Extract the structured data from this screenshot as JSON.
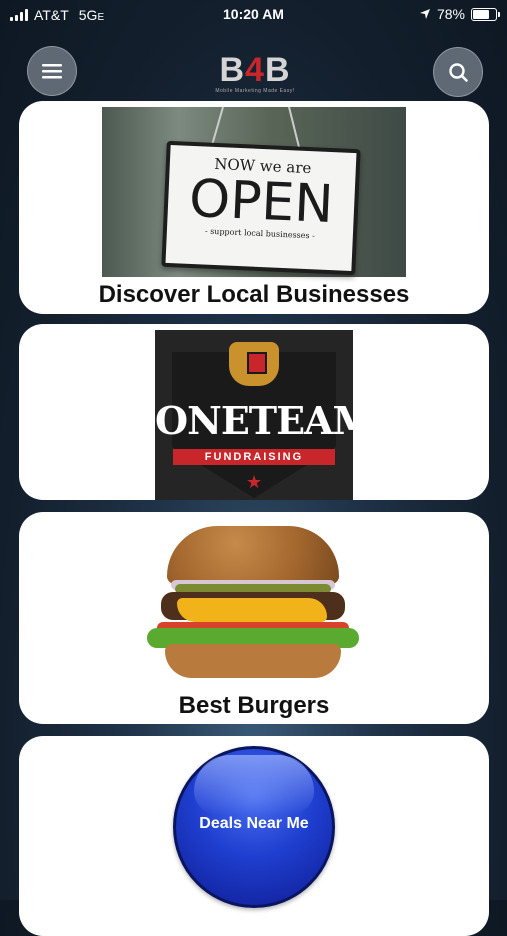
{
  "status_bar": {
    "carrier": "AT&T",
    "network": "5G",
    "network_suffix": "E",
    "time": "10:20 AM",
    "battery": "78%",
    "battery_level": 0.78
  },
  "header": {
    "logo_text_b1": "B",
    "logo_text_4": "4",
    "logo_text_b2": "B",
    "logo_subtitle": "Mobile Marketing Made Easy!",
    "menu_icon": "hamburger-icon",
    "search_icon": "search-icon"
  },
  "cards": [
    {
      "title": "Discover Local Businesses",
      "sign_top": "NOW we are",
      "sign_main": "OPEN",
      "sign_bottom": "- support local businesses -"
    },
    {
      "brand": "ONETEAM",
      "ribbon": "FUNDRAISING"
    },
    {
      "title": "Best Burgers"
    },
    {
      "button_label": "Deals Near Me"
    }
  ],
  "colors": {
    "accent_red": "#c8262a",
    "button_blue": "#1f3fd0"
  }
}
